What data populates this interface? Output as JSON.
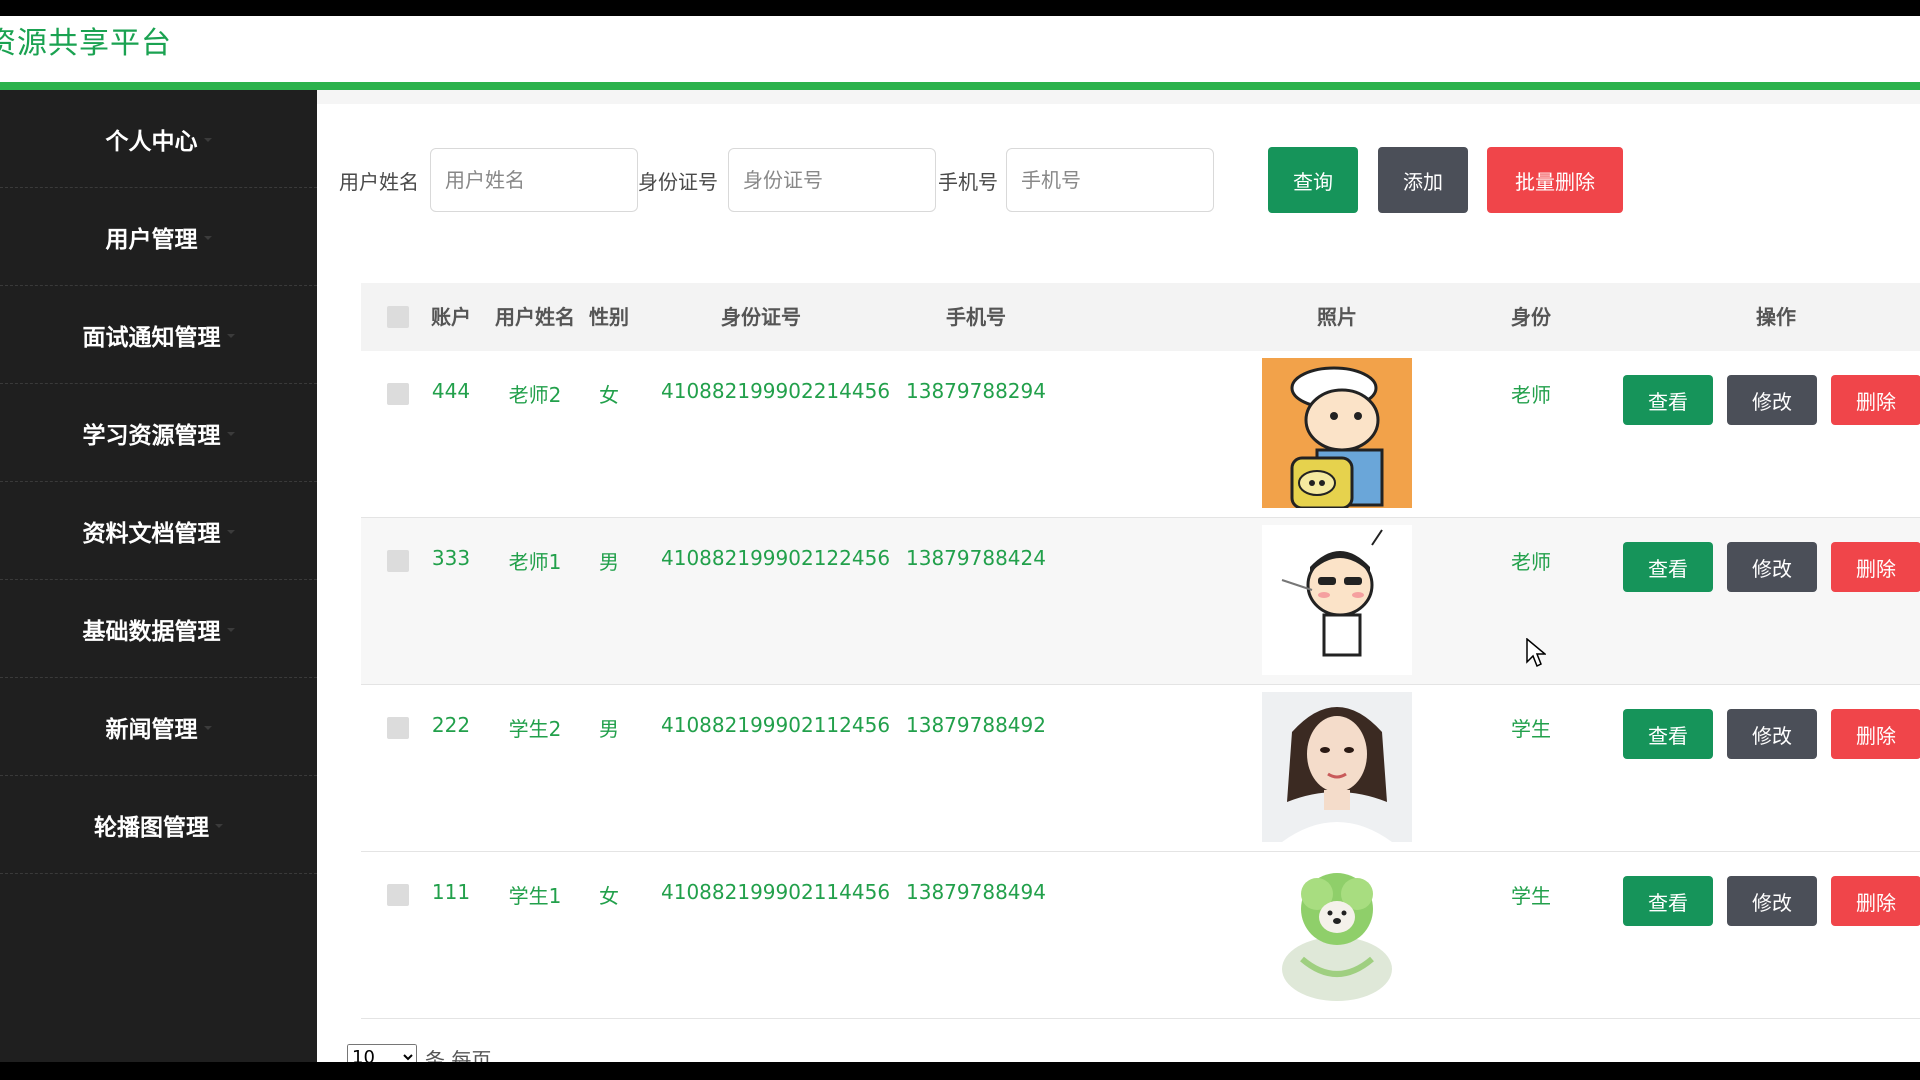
{
  "app": {
    "title": "资源共享平台"
  },
  "colors": {
    "accent": "#2bb24c",
    "sidebar_bg": "#1f1f1f",
    "btn_green": "#16945a",
    "btn_gray": "#4b4f58",
    "btn_red": "#f0454a",
    "text_green": "#22a04b"
  },
  "sidebar": {
    "items": [
      {
        "label": "个人中心"
      },
      {
        "label": "用户管理"
      },
      {
        "label": "面试通知管理"
      },
      {
        "label": "学习资源管理"
      },
      {
        "label": "资料文档管理"
      },
      {
        "label": "基础数据管理"
      },
      {
        "label": "新闻管理"
      },
      {
        "label": "轮播图管理"
      }
    ]
  },
  "search": {
    "name_label": "用户姓名",
    "name_placeholder": "用户姓名",
    "id_label": "身份证号",
    "id_placeholder": "身份证号",
    "phone_label": "手机号",
    "phone_placeholder": "手机号",
    "query_btn": "查询",
    "add_btn": "添加",
    "batch_delete_btn": "批量删除"
  },
  "table": {
    "headers": {
      "account": "账户",
      "name": "用户姓名",
      "gender": "性别",
      "id_no": "身份证号",
      "phone": "手机号",
      "photo": "照片",
      "role": "身份",
      "actions": "操作"
    },
    "rows": [
      {
        "account": "444",
        "name": "老师2",
        "gender": "女",
        "id_no": "410882199902214456",
        "phone": "13879788294",
        "photo": "cartoon-boy-backpack",
        "role": "老师"
      },
      {
        "account": "333",
        "name": "老师1",
        "gender": "男",
        "id_no": "410882199902122456",
        "phone": "13879788424",
        "photo": "cartoon-boy-sunglasses",
        "role": "老师"
      },
      {
        "account": "222",
        "name": "学生2",
        "gender": "男",
        "id_no": "410882199902112456",
        "phone": "13879788492",
        "photo": "woman-portrait",
        "role": "学生"
      },
      {
        "account": "111",
        "name": "学生1",
        "gender": "女",
        "id_no": "410882199902114456",
        "phone": "13879788494",
        "photo": "cabbage-dog",
        "role": "学生"
      }
    ],
    "action_labels": {
      "view": "查看",
      "edit": "修改",
      "delete": "删除"
    }
  },
  "pager": {
    "page_size": "10",
    "per_page_label": "条 每页"
  }
}
